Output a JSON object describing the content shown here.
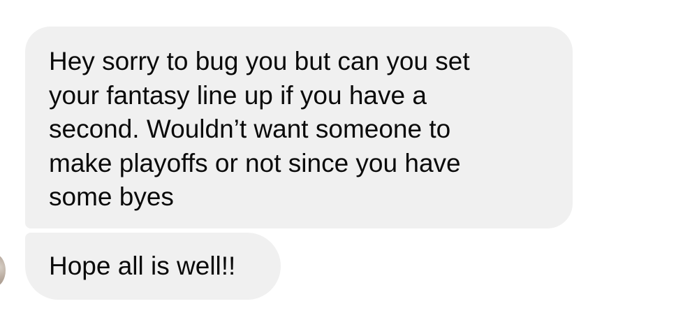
{
  "conversation": {
    "messages": [
      {
        "text": "Hey sorry to bug you but can you set\nyour fantasy line up if you have a\nsecond. Wouldn’t want someone to\nmake playoffs or not since you have\nsome byes"
      },
      {
        "text": "Hope all is well!!"
      }
    ]
  },
  "colors": {
    "bubble_background": "#f0f0f0",
    "text": "#0a0a0a",
    "background": "#ffffff"
  }
}
